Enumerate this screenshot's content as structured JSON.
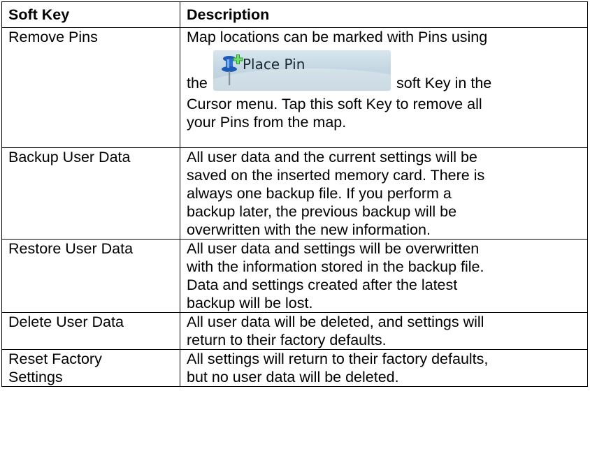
{
  "table": {
    "headers": [
      "Soft Key",
      "Description"
    ],
    "rows": [
      {
        "key": "Remove Pins",
        "desc_pre": "Map locations can be marked with Pins using",
        "desc_the": "the",
        "button_label": "Place Pin",
        "button_icon": "place-pin-icon",
        "desc_after_button": "soft Key in the",
        "desc_post_1": "Cursor menu. Tap this soft Key to remove all",
        "desc_post_2": "your Pins from the map."
      },
      {
        "key": "Backup User Data",
        "lines": [
          "All user data and the current settings will be",
          "saved on the inserted memory card. There is",
          "always one backup file. If you perform a",
          "backup later, the previous backup will be",
          "overwritten with the new information."
        ]
      },
      {
        "key": "Restore User Data",
        "lines": [
          "All user data and settings will be overwritten",
          "with the information stored in the backup file.",
          "Data and settings created after the latest",
          "backup will be lost."
        ]
      },
      {
        "key": "Delete User Data",
        "lines": [
          "All user data will be deleted, and settings will",
          "return to their factory defaults."
        ]
      },
      {
        "key_lines": [
          "Reset Factory",
          "Settings"
        ],
        "lines": [
          "All settings will return to their factory defaults,",
          "but no user data will be deleted."
        ]
      }
    ]
  },
  "colors": {
    "button_bg": "#c4d7e2",
    "pin_blue": "#2a6fcf",
    "plus_green": "#3fbf3f"
  }
}
